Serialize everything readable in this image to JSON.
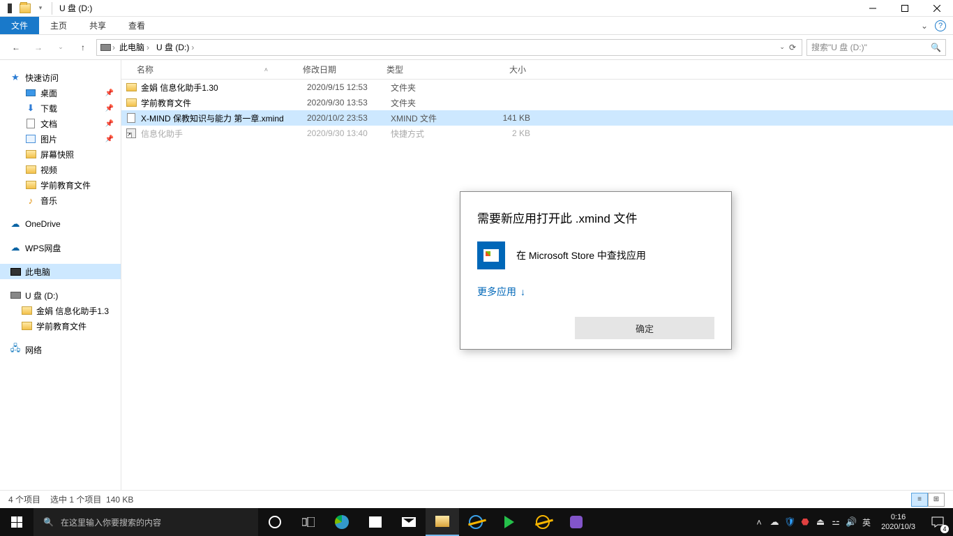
{
  "window": {
    "title": "U 盘 (D:)"
  },
  "ribbon": {
    "tabs": [
      "文件",
      "主页",
      "共享",
      "查看"
    ],
    "active": 0
  },
  "nav": {
    "crumbs": [
      "此电脑",
      "U 盘 (D:)"
    ],
    "search_placeholder": "搜索\"U 盘 (D:)\""
  },
  "sidebar": {
    "quick": {
      "label": "快速访问",
      "items": [
        {
          "label": "桌面",
          "icon": "desk",
          "pinned": true
        },
        {
          "label": "下载",
          "icon": "dl",
          "pinned": true
        },
        {
          "label": "文档",
          "icon": "doc",
          "pinned": true
        },
        {
          "label": "图片",
          "icon": "pic",
          "pinned": true
        },
        {
          "label": "屏幕快照",
          "icon": "folder"
        },
        {
          "label": "视频",
          "icon": "folder"
        },
        {
          "label": "学前教育文件",
          "icon": "folder"
        },
        {
          "label": "音乐",
          "icon": "music"
        }
      ]
    },
    "onedrive": "OneDrive",
    "wps": "WPS网盘",
    "thispc": "此电脑",
    "usb": {
      "label": "U 盘 (D:)",
      "items": [
        {
          "label": "金娟 信息化助手1.3"
        },
        {
          "label": "学前教育文件"
        }
      ]
    },
    "network": "网络"
  },
  "columns": {
    "name": "名称",
    "date": "修改日期",
    "type": "类型",
    "size": "大小"
  },
  "files": [
    {
      "name": "金娟 信息化助手1.30",
      "date": "2020/9/15 12:53",
      "type": "文件夹",
      "size": "",
      "icon": "folder"
    },
    {
      "name": "学前教育文件",
      "date": "2020/9/30 13:53",
      "type": "文件夹",
      "size": "",
      "icon": "folder"
    },
    {
      "name": "X-MIND 保教知识与能力 第一章.xmind",
      "date": "2020/10/2 23:53",
      "type": "XMIND 文件",
      "size": "141 KB",
      "icon": "file",
      "selected": true
    },
    {
      "name": "信息化助手",
      "date": "2020/9/30 13:40",
      "type": "快捷方式",
      "size": "2 KB",
      "icon": "shortcut",
      "dim": true
    }
  ],
  "dialog": {
    "title": "需要新应用打开此 .xmind 文件",
    "store_text": "在 Microsoft Store 中查找应用",
    "more": "更多应用",
    "ok": "确定"
  },
  "status": {
    "count": "4 个项目",
    "sel": "选中 1 个项目",
    "size": "140 KB"
  },
  "taskbar": {
    "search_placeholder": "在这里输入你要搜索的内容",
    "ime": "英",
    "time": "0:16",
    "date": "2020/10/3"
  }
}
